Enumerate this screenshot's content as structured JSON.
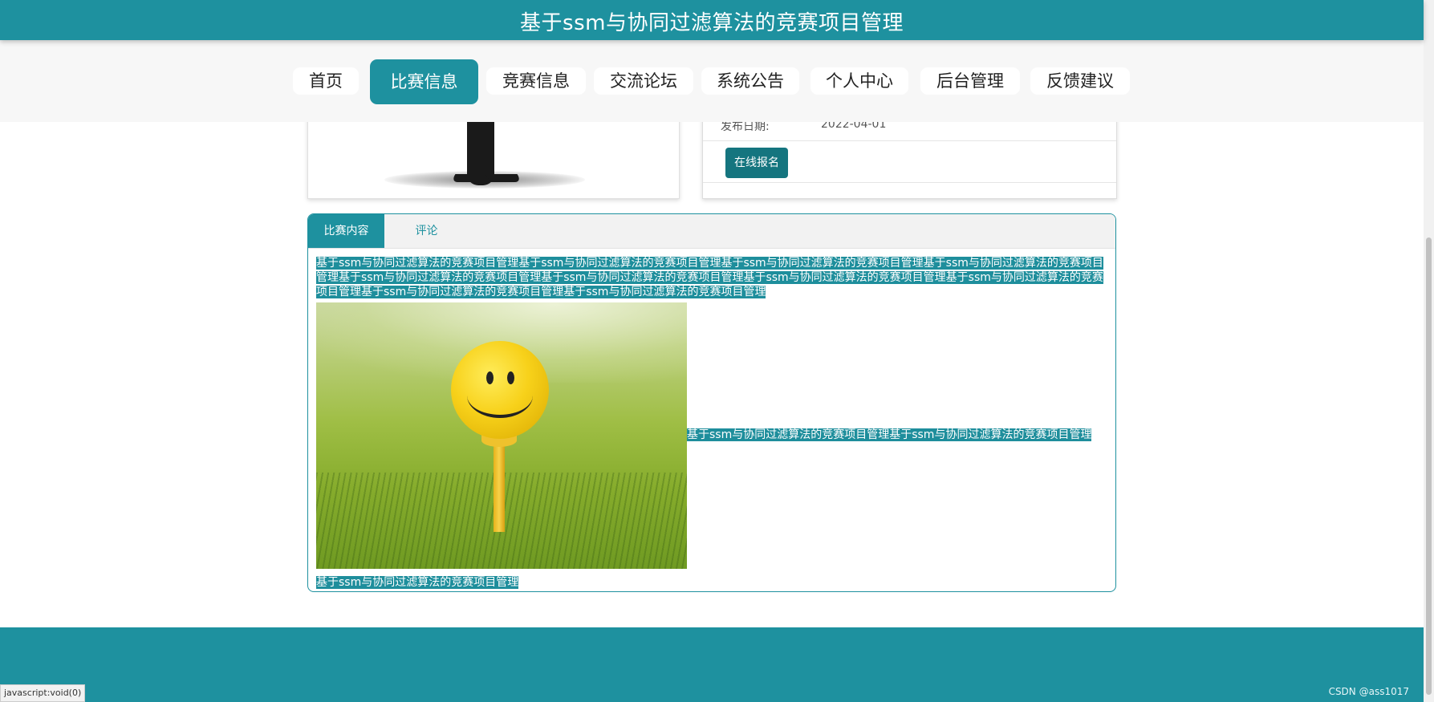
{
  "header": {
    "title": "基于ssm与协同过滤算法的竞赛项目管理"
  },
  "nav": {
    "items": [
      "首页",
      "比赛信息",
      "竞赛信息",
      "交流论坛",
      "系统公告",
      "个人中心",
      "后台管理",
      "反馈建议"
    ],
    "active": "比赛信息"
  },
  "info": {
    "date_label": "发布日期:",
    "date_value": "2022-04-01",
    "signup_button": "在线报名"
  },
  "tabs": {
    "content": "比赛内容",
    "comments": "评论"
  },
  "content": {
    "paragraph": "基于ssm与协同过滤算法的竞赛项目管理基于ssm与协同过滤算法的竞赛项目管理基于ssm与协同过滤算法的竞赛项目管理基于ssm与协同过滤算法的竞赛项目管理基于ssm与协同过滤算法的竞赛项目管理基于ssm与协同过滤算法的竞赛项目管理基于ssm与协同过滤算法的竞赛项目管理基于ssm与协同过滤算法的竞赛项目管理基于ssm与协同过滤算法的竞赛项目管理基于ssm与协同过滤算法的竞赛项目管理",
    "image_side_text": "基于ssm与协同过滤算法的竞赛项目管理基于ssm与协同过滤算法的竞赛项目管理",
    "bottom_text": "基于ssm与协同过滤算法的竞赛项目管理"
  },
  "status_bar": {
    "url": "javascript:void(0)"
  },
  "watermark": "CSDN @ass1017",
  "colors": {
    "primary": "#1e919f",
    "button": "#15757f",
    "nav_bg": "#f7f7f7"
  }
}
